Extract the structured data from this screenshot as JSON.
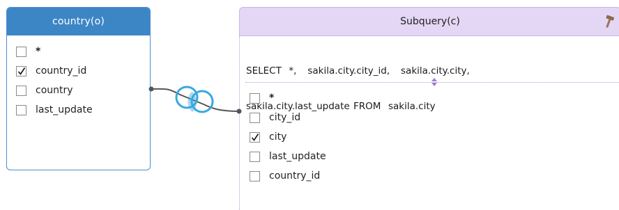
{
  "country_table": {
    "title": "country(o)",
    "columns": [
      {
        "label": "*",
        "checked": false
      },
      {
        "label": "country_id",
        "checked": true
      },
      {
        "label": "country",
        "checked": false
      },
      {
        "label": "last_update",
        "checked": false
      }
    ]
  },
  "subquery_table": {
    "title": "Subquery(c)",
    "sql_line1": "SELECT  *,   sakila.city.city_id,   sakila.city.city,",
    "sql_line2": "sakila.city.last_update FROM  sakila.city",
    "columns": [
      {
        "label": "*",
        "checked": false
      },
      {
        "label": "city_id",
        "checked": false
      },
      {
        "label": "city",
        "checked": true
      },
      {
        "label": "last_update",
        "checked": false
      },
      {
        "label": "country_id",
        "checked": false
      }
    ]
  },
  "join": {
    "type": "inner-join",
    "icon": "inner-join-venn-icon"
  },
  "colors": {
    "country_header": "#3d86c6",
    "country_border": "#4a8fd0",
    "subquery_header": "#e3d7f5",
    "subquery_border": "#c7b4e8",
    "join_circle": "#3aa8e0",
    "join_line": "#555555"
  }
}
